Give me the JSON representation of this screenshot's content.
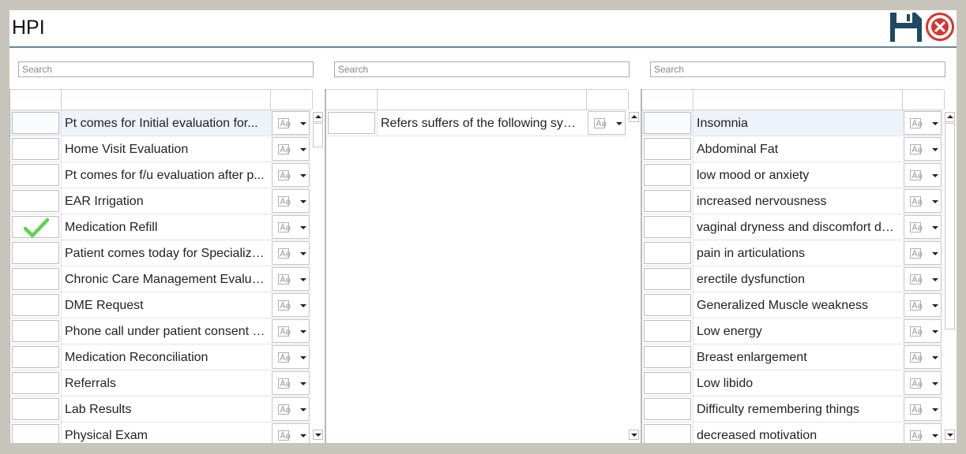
{
  "window": {
    "title": "HPI"
  },
  "toolbar": {
    "save_icon": "floppy-disk-icon",
    "close_icon": "close-circle-icon",
    "close_color": "#d9332a",
    "save_color": "#1f4863"
  },
  "panels": [
    {
      "search_placeholder": "Search",
      "items": [
        {
          "label": "Pt comes for Initial evaluation for...",
          "checked": false,
          "selected": true
        },
        {
          "label": "Home Visit Evaluation",
          "checked": false
        },
        {
          "label": "Pt comes for f/u evaluation after p...",
          "checked": false
        },
        {
          "label": "EAR Irrigation",
          "checked": false
        },
        {
          "label": "Medication Refill",
          "checked": true
        },
        {
          "label": "Patient comes today for Specialize...",
          "checked": false
        },
        {
          "label": "Chronic Care Management Evaluat...",
          "checked": false
        },
        {
          "label": "DME Request",
          "checked": false
        },
        {
          "label": "Phone call under patient consent a...",
          "checked": false
        },
        {
          "label": "Medication Reconciliation",
          "checked": false
        },
        {
          "label": "Referrals",
          "checked": false
        },
        {
          "label": "Lab Results",
          "checked": false
        },
        {
          "label": "Physical Exam",
          "checked": false
        }
      ]
    },
    {
      "search_placeholder": "Search",
      "items": [
        {
          "label": "Refers suffers of the following sym...",
          "checked": false
        }
      ]
    },
    {
      "search_placeholder": "Search",
      "items": [
        {
          "label": "Insomnia",
          "checked": false,
          "selected": true
        },
        {
          "label": "Abdominal Fat",
          "checked": false
        },
        {
          "label": "low mood or anxiety",
          "checked": false
        },
        {
          "label": "increased nervousness",
          "checked": false
        },
        {
          "label": "vaginal dryness and discomfort du...",
          "checked": false
        },
        {
          "label": "pain in articulations",
          "checked": false
        },
        {
          "label": "erectile dysfunction",
          "checked": false
        },
        {
          "label": "Generalized Muscle weakness",
          "checked": false
        },
        {
          "label": "Low energy",
          "checked": false
        },
        {
          "label": "Breast enlargement",
          "checked": false
        },
        {
          "label": "Low libido",
          "checked": false
        },
        {
          "label": "Difficulty remembering things",
          "checked": false
        },
        {
          "label": "decreased motivation",
          "checked": false
        }
      ]
    }
  ]
}
